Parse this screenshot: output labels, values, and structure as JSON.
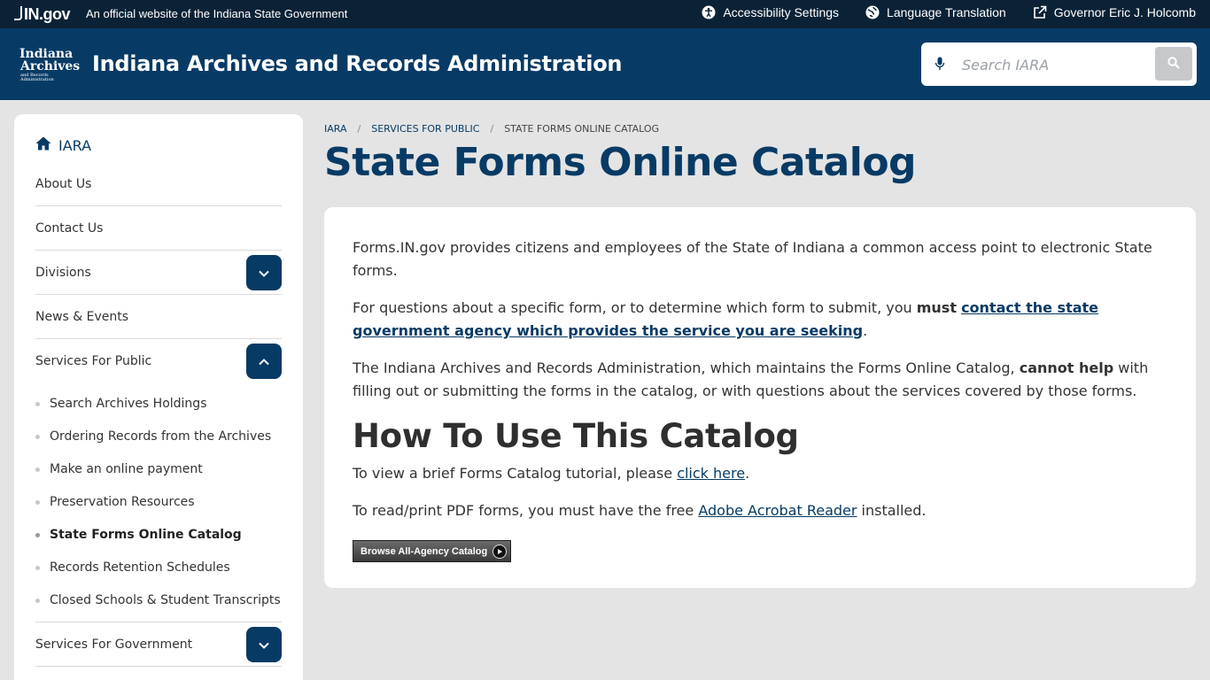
{
  "topbar": {
    "ingov_logo": "IN.gov",
    "official_text": "An official website of the Indiana State Government",
    "links": [
      {
        "label": "Accessibility Settings",
        "icon": "accessibility-icon"
      },
      {
        "label": "Language Translation",
        "icon": "globe-icon"
      },
      {
        "label": "Governor Eric J. Holcomb",
        "icon": "external-link-icon"
      }
    ]
  },
  "header": {
    "logo_line1": "Indiana",
    "logo_line2": "Archives",
    "logo_line3": "and Records Administration",
    "site_title": "Indiana Archives and Records Administration",
    "search_placeholder": "Search IARA"
  },
  "sidebar": {
    "home_label": "IARA",
    "items": [
      {
        "label": "About Us"
      },
      {
        "label": "Contact Us"
      },
      {
        "label": "Divisions",
        "toggle": "collapsed"
      },
      {
        "label": "News & Events"
      },
      {
        "label": "Services For Public",
        "toggle": "expanded"
      },
      {
        "label": "Services For Government",
        "toggle": "collapsed"
      }
    ],
    "sub_items": [
      {
        "label": "Search Archives Holdings"
      },
      {
        "label": "Ordering Records from the Archives"
      },
      {
        "label": "Make an online payment"
      },
      {
        "label": "Preservation Resources"
      },
      {
        "label": "State Forms Online Catalog",
        "active": true
      },
      {
        "label": "Records Retention Schedules"
      },
      {
        "label": "Closed Schools & Student Transcripts"
      }
    ]
  },
  "breadcrumb": {
    "items": [
      "IARA",
      "Services For Public",
      "State Forms Online Catalog"
    ],
    "separator": "/"
  },
  "main": {
    "page_title": "State Forms Online Catalog",
    "p1": "Forms.IN.gov provides citizens and employees of the State of Indiana a common access point to electronic State forms.",
    "p2_before": "For questions about a specific form, or to determine which form to submit, you ",
    "p2_bold": "must",
    "p2_space": " ",
    "p2_link": "contact the state government agency which provides the service you are seeking",
    "p2_after": ".",
    "p3_before": "The Indiana Archives and Records Administration, which maintains the Forms Online Catalog, ",
    "p3_bold": "cannot help",
    "p3_after": " with filling out or submitting the forms in the catalog, or with questions about the services covered by those forms.",
    "h2": "How To Use This Catalog",
    "p4_before": "To view a brief Forms Catalog tutorial, please ",
    "p4_link": "click here",
    "p4_after": ".",
    "p5_before": "To read/print PDF forms, you must have the free ",
    "p5_link": "Adobe Acrobat Reader",
    "p5_after": " installed.",
    "browse_button": "Browse All-Agency Catalog"
  },
  "colors": {
    "topbar_bg": "#0b2236",
    "header_bg": "#073b65",
    "accent": "#073b65",
    "page_bg": "#e4e4e4"
  }
}
